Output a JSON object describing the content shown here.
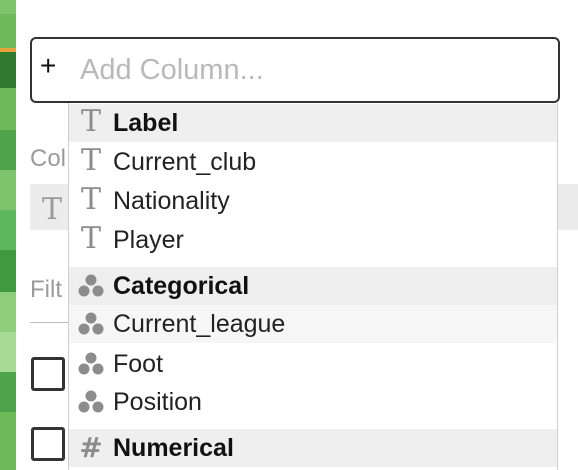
{
  "search": {
    "plus": "+",
    "placeholder": "Add Column..."
  },
  "background": {
    "columns_label": "Col",
    "filter_label": "Filt",
    "row_icon": "T"
  },
  "dropdown": {
    "groups": [
      {
        "label": "Label",
        "icon": "text-type-icon",
        "items": [
          "Current_club",
          "Nationality",
          "Player"
        ]
      },
      {
        "label": "Categorical",
        "icon": "categorical-type-icon",
        "items": [
          "Current_league",
          "Foot",
          "Position"
        ]
      },
      {
        "label": "Numerical",
        "icon": "hash-icon",
        "items": []
      }
    ]
  },
  "colors": {
    "strip_green": "#5cb85c",
    "strip_dark": "#2e7d32",
    "strip_orange": "#e8a33d",
    "icon_gray": "#8c8c8c"
  }
}
